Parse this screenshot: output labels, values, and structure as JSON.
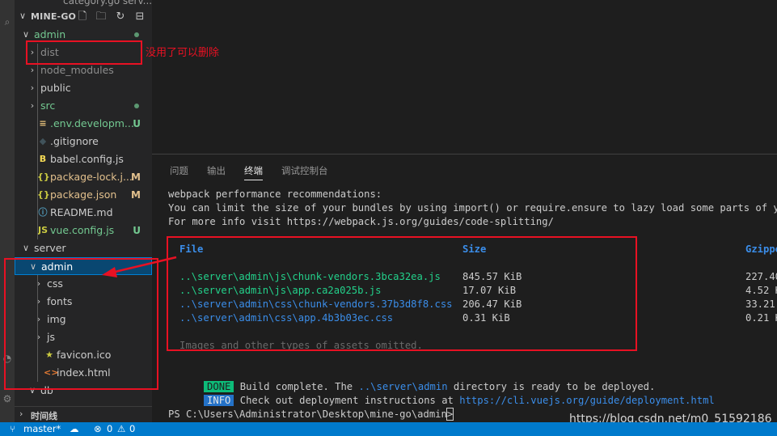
{
  "explorer": {
    "title": "MINE-GO",
    "top_clipped_item": "category.go serv..."
  },
  "tree": [
    {
      "label": "admin",
      "color": "#73c991",
      "chevron": "∨",
      "dot": true
    },
    {
      "label": "dist",
      "color": "#8c8c8c",
      "chevron": "›"
    },
    {
      "label": "node_modules",
      "color": "#8c8c8c",
      "chevron": "›"
    },
    {
      "label": "public",
      "color": "#cccccc",
      "chevron": "›"
    },
    {
      "label": "src",
      "color": "#73c991",
      "chevron": "›",
      "dot": true
    },
    {
      "label": ".env.developm...",
      "color": "#73c991",
      "badge": "U",
      "icon": "≡"
    },
    {
      "label": ".gitignore",
      "color": "#cccccc",
      "icon": "◆"
    },
    {
      "label": "babel.config.js",
      "color": "#cccccc",
      "icon": "B"
    },
    {
      "label": "package-lock.j...",
      "color": "#e2c08d",
      "badge": "M",
      "icon": "{}"
    },
    {
      "label": "package.json",
      "color": "#e2c08d",
      "badge": "M",
      "icon": "{}"
    },
    {
      "label": "README.md",
      "color": "#cccccc",
      "icon": "ⓘ"
    },
    {
      "label": "vue.config.js",
      "color": "#73c991",
      "badge": "U",
      "icon": "JS"
    },
    {
      "label": "server",
      "color": "#cccccc",
      "chevron": "∨"
    },
    {
      "label": "admin",
      "color": "#ffffff",
      "chevron": "∨"
    },
    {
      "label": "css",
      "color": "#cccccc",
      "chevron": "›"
    },
    {
      "label": "fonts",
      "color": "#cccccc",
      "chevron": "›"
    },
    {
      "label": "img",
      "color": "#cccccc",
      "chevron": "›"
    },
    {
      "label": "js",
      "color": "#cccccc",
      "chevron": "›"
    },
    {
      "label": "favicon.ico",
      "color": "#cccccc",
      "icon": "★"
    },
    {
      "label": "index.html",
      "color": "#cccccc",
      "icon": "<>"
    },
    {
      "label": "db",
      "color": "#cccccc",
      "chevron": "∨"
    }
  ],
  "annotation": {
    "text": "没用了可以删除"
  },
  "panel": {
    "tabs": [
      "问题",
      "输出",
      "终端",
      "调试控制台"
    ],
    "active_tab": "终端"
  },
  "terminal": {
    "perf_lines": [
      "webpack performance recommendations:",
      "You can limit the size of your bundles by using import() or require.ensure to lazy load some parts of your a",
      "For more info visit https://webpack.js.org/guides/code-splitting/"
    ],
    "headers": {
      "file": "File",
      "size": "Size",
      "gzipped": "Gzippe"
    },
    "rows": [
      {
        "file": "..\\server\\admin\\js\\chunk-vendors.3bca32ea.js",
        "size": "845.57 KiB",
        "gzip": "227.40",
        "kind": "js"
      },
      {
        "file": "..\\server\\admin\\js\\app.ca2a025b.js",
        "size": "17.07 KiB",
        "gzip": "4.52 K",
        "kind": "js"
      },
      {
        "file": "..\\server\\admin\\css\\chunk-vendors.37b3d8f8.css",
        "size": "206.47 KiB",
        "gzip": "33.21",
        "kind": "css"
      },
      {
        "file": "..\\server\\admin\\css\\app.4b3b03ec.css",
        "size": "0.31 KiB",
        "gzip": "0.21 K",
        "kind": "css"
      }
    ],
    "omitted": "Images and other types of assets omitted.",
    "done_tag": "DONE",
    "done_pre": "Build complete. The ",
    "done_path": "..\\server\\admin",
    "done_post": " directory is ready to be deployed.",
    "info_tag": "INFO",
    "info_pre": "Check out deployment instructions at ",
    "info_link": "https://cli.vuejs.org/guide/deployment.html",
    "prompt": "PS C:\\Users\\Administrator\\Desktop\\mine-go\\admin> "
  },
  "timeline": {
    "label": "时间线"
  },
  "statusbar": {
    "branch": "master*",
    "errors": "0",
    "warnings": "0"
  },
  "watermark": "https://blog.csdn.net/m0_51592186",
  "colors": {
    "accent": "#007acc",
    "annotation_red": "#e81123",
    "git_untracked": "#73c991",
    "git_modified": "#e2c08d"
  }
}
